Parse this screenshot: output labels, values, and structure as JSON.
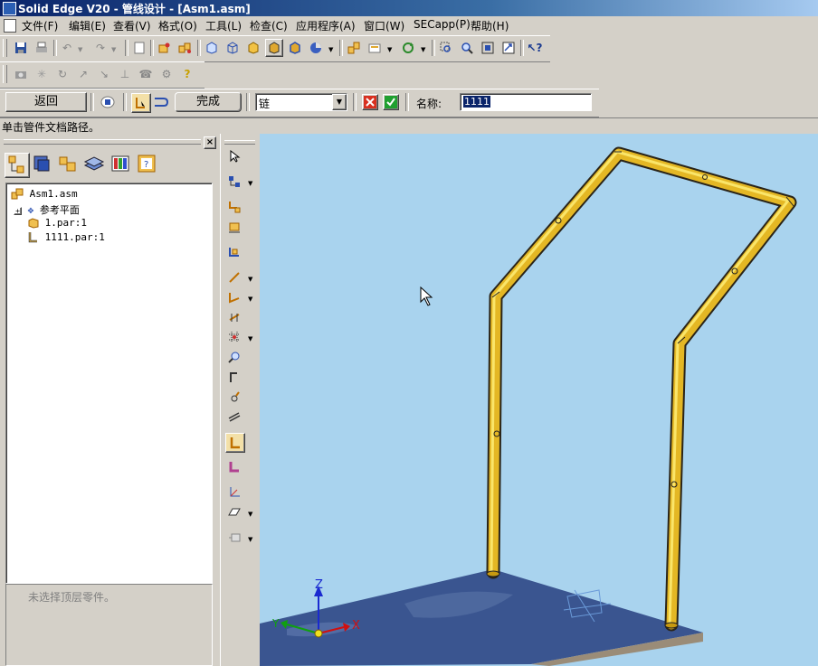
{
  "window": {
    "title": "Solid Edge V20 - 管线设计 - [Asm1.asm]"
  },
  "menu": [
    "文件(F)",
    "编辑(E)",
    "查看(V)",
    "格式(O)",
    "工具(L)",
    "检查(C)",
    "应用程序(A)",
    "窗口(W)",
    "SECapp(P)",
    "帮助(H)"
  ],
  "ribbon": {
    "back_label": "返回",
    "finish_label": "完成",
    "select_value": "链",
    "name_label": "名称:",
    "name_value": "1111"
  },
  "status_prompt": "单击管件文档路径。",
  "tree": {
    "root": "Asm1.asm",
    "items": [
      "参考平面",
      "1.par:1",
      "1111.par:1"
    ],
    "expand_glyph": "+"
  },
  "details_text": "未选择顶层零件。",
  "triad": {
    "z": "Z",
    "y": "Y",
    "x": "X"
  },
  "icons": {
    "toolbar1": [
      "save-icon",
      "print-icon",
      "undo-icon",
      "redo-icon",
      "blank-doc-icon",
      "part-insert-icon",
      "explode-icon",
      "box-view-icon",
      "box-wire-icon",
      "box-shaded-icon",
      "shade-icon",
      "shade-edges-icon",
      "sphere-icon",
      "assembly-icon",
      "print-preview-icon",
      "rotate-icon",
      "zoom-area-icon",
      "zoom-icon",
      "fit-icon",
      "pan-icon",
      "whats-this-icon"
    ],
    "toolbar2": [
      "camera-icon",
      "sun-icon",
      "arc-icon",
      "arrow-ne-icon",
      "arrow-se-icon",
      "anchor-icon",
      "pipe-icon",
      "help-bulb-icon"
    ],
    "tabs": [
      "feature-tab-icon",
      "layers-tab-icon",
      "parts-tab-icon",
      "sheets-tab-icon",
      "colors-tab-icon",
      "properties-tab-icon"
    ],
    "vertical": [
      "select-arrow-icon",
      "pipe-path-icon",
      "route-icon",
      "fitting-icon",
      "assembly-pipe-icon",
      "line-icon",
      "corner-icon",
      "dim-icon",
      "grid-icon",
      "magnify-icon",
      "trim-icon",
      "rotate-arc-icon",
      "parallel-icon",
      "pipe-tool-icon",
      "elbow-icon",
      "axes-icon",
      "plane-icon",
      "camera-view-icon"
    ]
  },
  "colors": {
    "viewport_bg": "#a9d3ee",
    "pipe": "#e4b724",
    "plate": "#3a5590",
    "titlebar": "#0a246a"
  }
}
